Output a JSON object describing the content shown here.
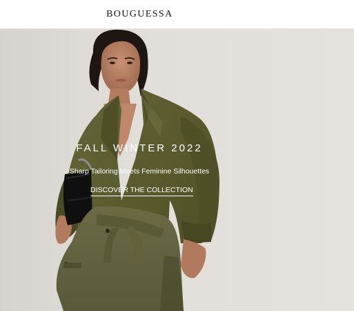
{
  "header": {
    "brand": "BOUGUESSA"
  },
  "hero": {
    "title": "FALL WINTER 2022",
    "subtitle": "Sharp Tailoring Meets Feminine Silhouettes",
    "cta_label": "DISCOVER THE COLLECTION"
  },
  "colors": {
    "background": "#e2dfda",
    "coat": "#5a5a2c",
    "text_on_image": "#ffffff",
    "brand_text": "#151515"
  }
}
